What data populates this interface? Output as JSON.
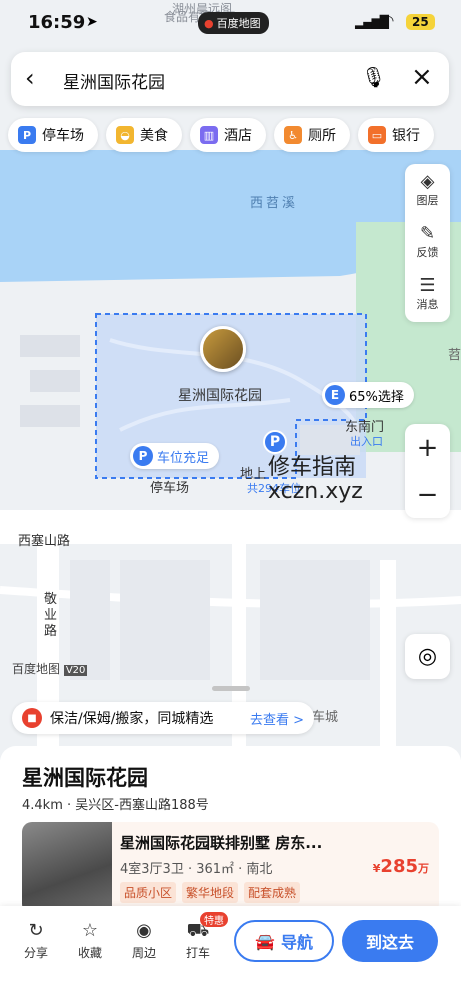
{
  "status_bar": {
    "time": "16:59",
    "location_icon": "location-arrow-icon",
    "map_badge": "百度地图",
    "battery": "25"
  },
  "search": {
    "query": "星洲国际花园"
  },
  "categories": [
    {
      "label": "停车场",
      "icon": "parking-icon",
      "color": "#3a7bf0"
    },
    {
      "label": "美食",
      "icon": "food-icon",
      "color": "#f2b630"
    },
    {
      "label": "酒店",
      "icon": "hotel-icon",
      "color": "#7b6cf0"
    },
    {
      "label": "厕所",
      "icon": "toilet-icon",
      "color": "#f28a30"
    },
    {
      "label": "银行",
      "icon": "bank-icon",
      "color": "#f2702b"
    }
  ],
  "right_tools": [
    {
      "label": "图层",
      "icon": "layers-icon"
    },
    {
      "label": "反馈",
      "icon": "feedback-icon"
    },
    {
      "label": "消息",
      "icon": "message-icon"
    }
  ],
  "map": {
    "top_label_1": "湖州晨远阁",
    "top_label_2": "食品有限公司",
    "river_label": "西苕溪",
    "poi_name": "星洲国际花园",
    "select_tag": "65%选择",
    "gate_label": "东南门",
    "gate_sub": "出入口",
    "parking_tag": "车位充足",
    "parking_label": "停车场",
    "ground_parking": "地上",
    "parking_count": "共294车位",
    "road_1": "西塞山路",
    "road_2": "敬业路",
    "edge_char": "苕",
    "brand": "百度地图",
    "brand_version": "V20",
    "bottom_right_label": "车城"
  },
  "watermark": {
    "line1": "修车指南",
    "line2": "xczn.xyz"
  },
  "promo": {
    "text": "保洁/保姆/搬家，同城精选",
    "link": "去查看 >"
  },
  "place": {
    "name": "星洲国际花园",
    "address": "4.4km · 吴兴区-西塞山路188号",
    "listing": {
      "title": "星洲国际花园联排别墅 房东...",
      "meta": "4室3厅3卫 · 361㎡ · 南北",
      "price_prefix": "¥",
      "price": "285",
      "price_unit": "万",
      "badges": [
        "品质小区",
        "繁华地段",
        "配套成熟"
      ]
    }
  },
  "bottom_bar": {
    "items": [
      {
        "label": "分享",
        "icon": "share-icon"
      },
      {
        "label": "收藏",
        "icon": "star-icon"
      },
      {
        "label": "周边",
        "icon": "compass-icon"
      },
      {
        "label": "打车",
        "icon": "taxi-icon"
      }
    ],
    "hot_badge": "特惠",
    "nav_label": "导航",
    "go_label": "到这去"
  }
}
